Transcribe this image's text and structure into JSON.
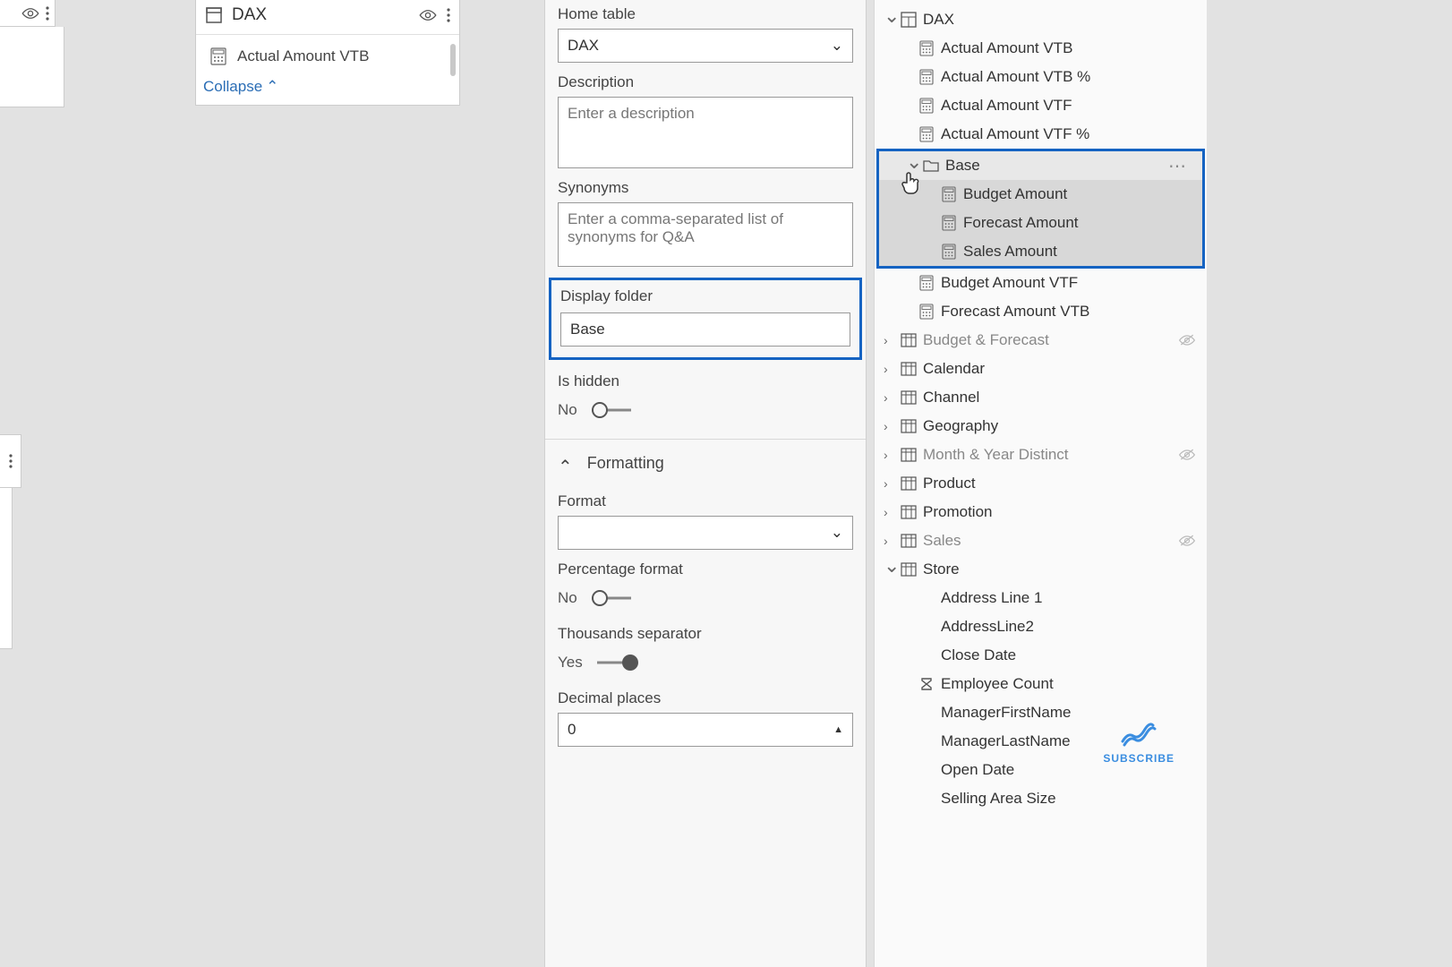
{
  "dax_card": {
    "title": "DAX",
    "measure": "Actual Amount VTB",
    "collapse": "Collapse"
  },
  "props": {
    "home_table_label": "Home table",
    "home_table_value": "DAX",
    "description_label": "Description",
    "description_placeholder": "Enter a description",
    "synonyms_label": "Synonyms",
    "synonyms_placeholder": "Enter a comma-separated list of synonyms for Q&A",
    "display_folder_label": "Display folder",
    "display_folder_value": "Base",
    "is_hidden_label": "Is hidden",
    "is_hidden_value": "No",
    "formatting_section": "Formatting",
    "format_label": "Format",
    "format_value": "",
    "pct_label": "Percentage format",
    "pct_value": "No",
    "thousands_label": "Thousands separator",
    "thousands_value": "Yes",
    "decimals_label": "Decimal places",
    "decimals_value": "0"
  },
  "fields": {
    "dax": "DAX",
    "measures": [
      "Actual Amount VTB",
      "Actual Amount VTB %",
      "Actual Amount VTF",
      "Actual Amount VTF %"
    ],
    "base_folder": "Base",
    "base_items": [
      "Budget Amount",
      "Forecast Amount",
      "Sales Amount"
    ],
    "after_base": [
      "Budget Amount VTF",
      "Forecast Amount VTB"
    ],
    "tables": [
      {
        "name": "Budget & Forecast",
        "hidden": true
      },
      {
        "name": "Calendar",
        "hidden": false
      },
      {
        "name": "Channel",
        "hidden": false
      },
      {
        "name": "Geography",
        "hidden": false
      },
      {
        "name": "Month & Year Distinct",
        "hidden": true
      },
      {
        "name": "Product",
        "hidden": false
      },
      {
        "name": "Promotion",
        "hidden": false
      },
      {
        "name": "Sales",
        "hidden": true
      }
    ],
    "store": "Store",
    "store_cols": [
      "Address Line 1",
      "AddressLine2",
      "Close Date",
      "Employee Count",
      "ManagerFirstName",
      "ManagerLastName",
      "Open Date",
      "Selling Area Size"
    ]
  },
  "subscribe": "SUBSCRIBE"
}
